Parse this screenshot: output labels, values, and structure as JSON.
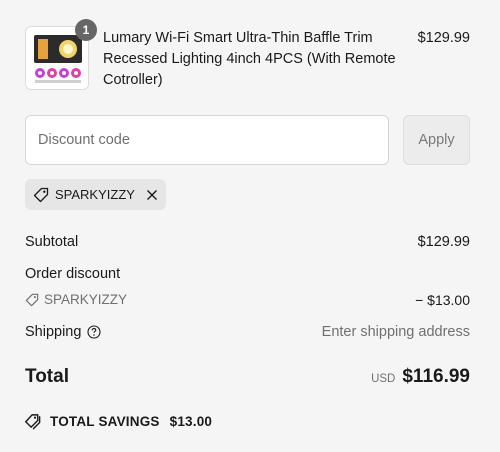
{
  "product": {
    "quantity": "1",
    "name": "Lumary Wi-Fi Smart Ultra-Thin Baffle Trim Recessed Lighting 4inch 4PCS (With Remote Cotroller)",
    "price": "$129.99",
    "image_icon": "product-image"
  },
  "discount": {
    "placeholder": "Discount code",
    "apply_label": "Apply",
    "applied_code": "SPARKYIZZY"
  },
  "summary": {
    "subtotal_label": "Subtotal",
    "subtotal_value": "$129.99",
    "order_discount_label": "Order discount",
    "discount_code": "SPARKYIZZY",
    "discount_value": "− $13.00",
    "shipping_label": "Shipping",
    "shipping_value": "Enter shipping address",
    "total_label": "Total",
    "total_currency": "USD",
    "total_value": "$116.99"
  },
  "savings": {
    "label": "TOTAL SAVINGS",
    "value": "$13.00"
  },
  "colors": {
    "background": "#f5f5f5",
    "muted_text": "#707070",
    "badge": "#666666"
  }
}
